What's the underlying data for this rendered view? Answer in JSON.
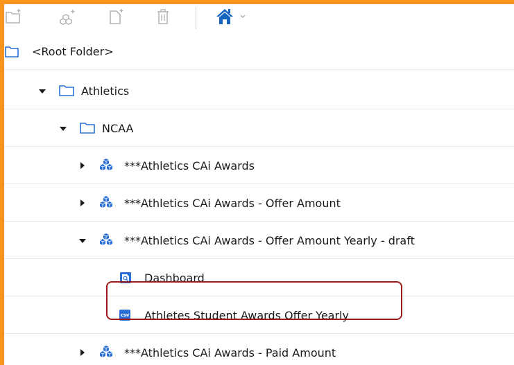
{
  "toolbar": {
    "icons": [
      "new-folder-icon",
      "new-cube-icon",
      "new-document-icon",
      "delete-icon",
      "home-icon",
      "chevron-down-icon"
    ]
  },
  "tree": {
    "root": {
      "label": "<Root Folder>"
    },
    "athletics": {
      "label": "Athletics"
    },
    "ncaa": {
      "label": "NCAA"
    },
    "item1": {
      "label": "***Athletics CAi Awards"
    },
    "item2": {
      "label": "***Athletics CAi Awards - Offer Amount"
    },
    "item3": {
      "label": "***Athletics CAi Awards - Offer Amount Yearly - draft"
    },
    "dashboard": {
      "label": "Dashboard"
    },
    "csv_item": {
      "label": "Athletes Student Awards Offer Yearly",
      "badge": "csv"
    },
    "item4": {
      "label": "***Athletics CAi Awards - Paid Amount"
    }
  },
  "colors": {
    "frame_accent": "#f7941d",
    "home_icon": "#1565c0",
    "folder_icon": "#2a6fd6",
    "cube_icon": "#2a6fd6",
    "highlight_border": "#9b1b1b"
  }
}
